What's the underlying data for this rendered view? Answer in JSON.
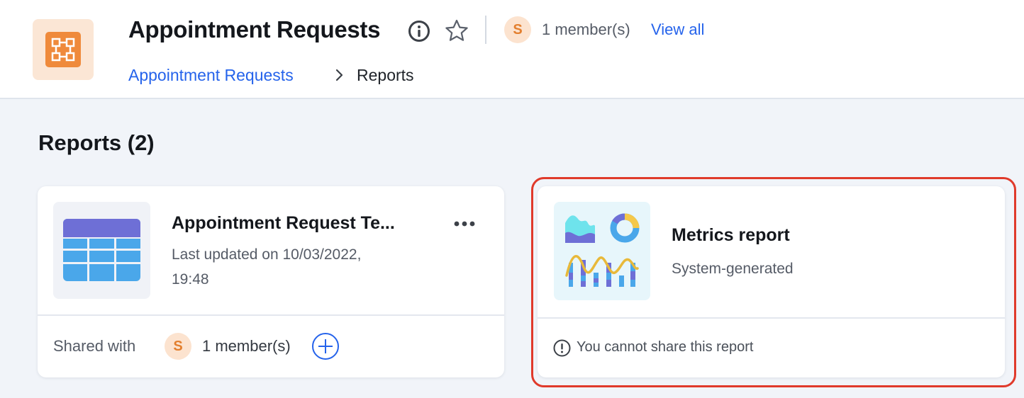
{
  "header": {
    "title": "Appointment Requests",
    "avatar_letter": "S",
    "members": "1 member(s)",
    "view_all": "View all",
    "breadcrumb": {
      "parent": "Appointment Requests",
      "current": "Reports"
    }
  },
  "section": {
    "title": "Reports (2)"
  },
  "reports": [
    {
      "title": "Appointment Request Te...",
      "subtitle_line1": "Last updated on 10/03/2022,",
      "subtitle_line2": "19:48",
      "shared_label": "Shared with",
      "avatar_letter": "S",
      "members": "1 member(s)",
      "icon": "table-icon"
    },
    {
      "title": "Metrics report",
      "subtitle": "System-generated",
      "notice": "You cannot share this report",
      "icon": "metrics-chart-icon",
      "highlighted": true
    }
  ],
  "colors": {
    "accent": "#2563eb",
    "app_icon_bg": "#fbe6d5",
    "app_icon": "#ef8a3b",
    "highlight": "#e03a2b",
    "avatar_bg": "#fce3cf",
    "avatar_text": "#e37f2e"
  }
}
